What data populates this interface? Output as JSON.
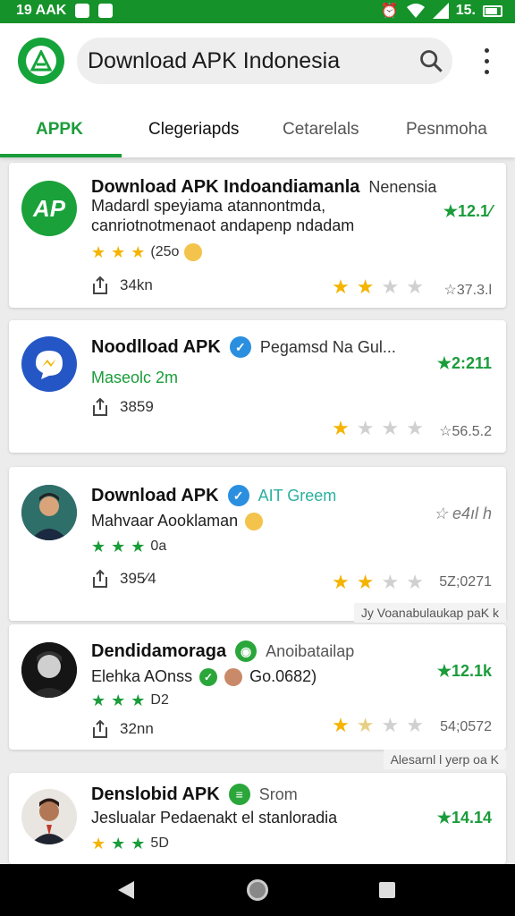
{
  "status_bar": {
    "time": "19 AAK",
    "battery": "15.",
    "signal_icon": "signal-icon",
    "wifi_icon": "wifi-icon",
    "alarm_icon": "alarm-icon"
  },
  "header": {
    "search_text": "Download APK Indonesia",
    "search_icon": "search-icon",
    "menu_icon": "more-vert-icon",
    "brand_color": "#1a9c3a"
  },
  "tabs": [
    {
      "label": "APPK"
    },
    {
      "label": "Clegeriapds"
    },
    {
      "label": "Cetarelals"
    },
    {
      "label": "Pesnmoha"
    }
  ],
  "apps": [
    {
      "title": "Download APK Indoandiamanla",
      "title_sub": "Nenensia",
      "desc_line1": "Madardl speyiama atannontmda,",
      "desc_line2": "canriotnotmenaot andapenp ndadam",
      "avatar_text": "AP",
      "rating_count": "(25o",
      "stars": "y,y,y",
      "downloads": "34kn",
      "right_rating": "★12.1⁄",
      "stars_bottom": "y,y,e,e",
      "stars_num": "☆37.3.l"
    },
    {
      "title": "Noodlload APK",
      "title_sub": "Pegamsd Na Gul...",
      "desc_line1": "Maseolc 2m",
      "downloads": "3859",
      "right_rating": "★2:211",
      "stars_bottom": "y,e,e,e",
      "stars_num": "☆56.5.2"
    },
    {
      "title": "Download APK",
      "title_sub": "AIT Greem",
      "desc_line1": "Mahvaar Aooklaman",
      "stars": "g,g,g",
      "rating_count": "0a",
      "downloads": "395⁄4",
      "right_rating": "☆ e4ıl h",
      "stars_bottom": "y,y,e,e",
      "stars_num": "5Z;0271",
      "footer": "Jy Voanabulaukap paK k"
    },
    {
      "title": "Dendidamoraga",
      "title_sub": "Anoibatailap",
      "desc_line1": "Elehka AOnss",
      "desc_extra": "Go.0682)",
      "stars": "g,g,g",
      "rating_count": "D2",
      "downloads": "32nn",
      "right_rating": "★12.1k",
      "stars_bottom": "y,y,e,e",
      "stars_num": "54;0572",
      "footer": "Alesarnl l yerp oa K"
    },
    {
      "title": "Denslobid APK",
      "title_sub": "Srom",
      "desc_line1": "Jeslualar Pedaenakt el stanloradia",
      "stars": "y,g,g",
      "rating_count": "5D",
      "right_rating": "★14.14"
    }
  ],
  "nav": {
    "back_icon": "back-icon",
    "home_icon": "home-icon",
    "recents_icon": "recents-icon"
  }
}
